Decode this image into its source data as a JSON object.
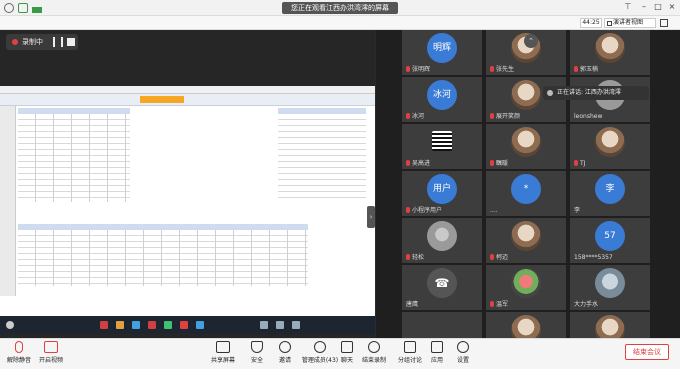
{
  "titlebar": {
    "title": "您正在观看江西办洪湾澪的屏幕"
  },
  "subbar": {
    "timer": "44:25",
    "view_label": "演讲者视图"
  },
  "recording": {
    "label": "录制中"
  },
  "speaker": {
    "tooltip": "正在讲话: 江西办洪湾澪"
  },
  "participants": [
    {
      "name": "张明辉",
      "avatar_text": "明辉",
      "avatar_color": "#3a7bd5"
    },
    {
      "name": "张先生",
      "avatar_text": "",
      "avatar_color": ""
    },
    {
      "name": "郭玉楠",
      "avatar_text": "",
      "avatar_color": ""
    },
    {
      "name": "冰河",
      "avatar_text": "冰河",
      "avatar_color": "#3a7bd5"
    },
    {
      "name": "展开笑颜",
      "avatar_text": "",
      "avatar_color": ""
    },
    {
      "name": "leonshew",
      "avatar_text": "",
      "avatar_color": ""
    },
    {
      "name": "吴高进",
      "avatar_text": "",
      "avatar_color": ""
    },
    {
      "name": "瞩暖",
      "avatar_text": "",
      "avatar_color": ""
    },
    {
      "name": "TJ",
      "avatar_text": "",
      "avatar_color": ""
    },
    {
      "name": "小程序用户",
      "avatar_text": "用户",
      "avatar_color": "#3a7bd5"
    },
    {
      "name": "....",
      "avatar_text": "*",
      "avatar_color": "#3a7bd5"
    },
    {
      "name": "李",
      "avatar_text": "李",
      "avatar_color": "#3a7bd5"
    },
    {
      "name": "轻松",
      "avatar_text": "",
      "avatar_color": ""
    },
    {
      "name": "柯迈",
      "avatar_text": "",
      "avatar_color": ""
    },
    {
      "name": "158****5357",
      "avatar_text": "57",
      "avatar_color": "#3a7bd5"
    },
    {
      "name": "唐鹰",
      "avatar_text": "",
      "avatar_color": ""
    },
    {
      "name": "温军",
      "avatar_text": "",
      "avatar_color": ""
    },
    {
      "name": "大力手水",
      "avatar_text": "",
      "avatar_color": ""
    },
    {
      "name": "",
      "avatar_text": "",
      "avatar_color": ""
    },
    {
      "name": "",
      "avatar_text": "",
      "avatar_color": ""
    },
    {
      "name": "",
      "avatar_text": "",
      "avatar_color": ""
    }
  ],
  "toolbar": {
    "mute": "解除静音",
    "video": "开启视频",
    "share": "共享屏幕",
    "security": "安全",
    "docs": "邀请",
    "members": "管理成员(43)",
    "chat": "聊天",
    "record": "结束录制",
    "breakout": "分组讨论",
    "apps": "应用",
    "settings": "设置",
    "end": "结束会议"
  },
  "colors": {
    "accent": "#3a7bd5",
    "danger": "#e04040"
  }
}
